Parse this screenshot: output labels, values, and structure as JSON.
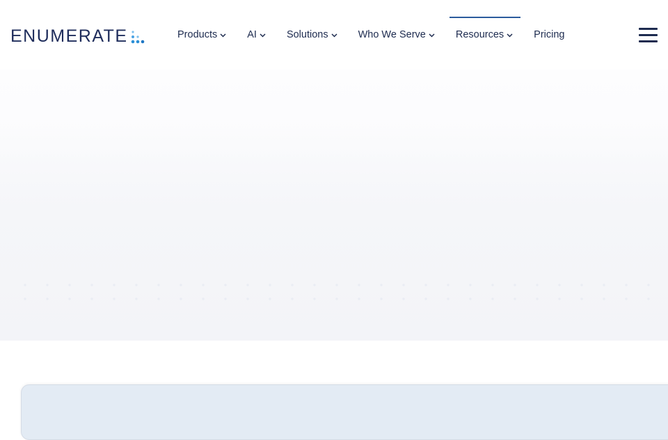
{
  "brand": {
    "name": "ENUMERATE",
    "text_color": "#1f2d5c",
    "dots_color": "#2a8fd6"
  },
  "nav": {
    "items": [
      {
        "label": "Products",
        "has_dropdown": true,
        "active": false
      },
      {
        "label": "AI",
        "has_dropdown": true,
        "active": false
      },
      {
        "label": "Solutions",
        "has_dropdown": true,
        "active": false
      },
      {
        "label": "Who We Serve",
        "has_dropdown": true,
        "active": false
      },
      {
        "label": "Resources",
        "has_dropdown": true,
        "active": true
      },
      {
        "label": "Pricing",
        "has_dropdown": false,
        "active": false
      }
    ],
    "active_indicator_color": "#2b5b9c"
  },
  "icons": {
    "dropdown": "chevron-down-icon",
    "menu": "hamburger-menu-icon"
  },
  "colors": {
    "text": "#1d2b4f",
    "hero_background": "#f5f6f9",
    "card_background": "#e3ebf4"
  }
}
